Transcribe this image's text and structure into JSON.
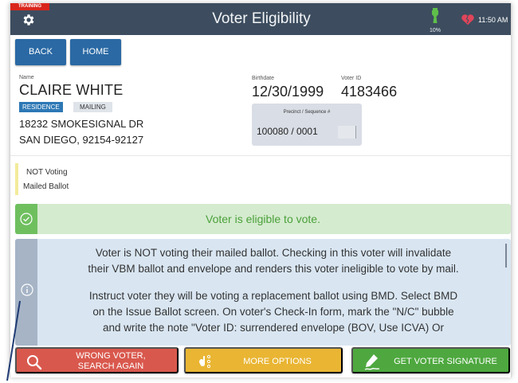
{
  "header": {
    "training_tag": "TRAINING",
    "title": "Voter Eligibility",
    "battery_percent": "10%",
    "clock": "11:50 AM"
  },
  "nav": {
    "back": "BACK",
    "home": "HOME"
  },
  "voter": {
    "name_label": "Name",
    "name": "CLAIRE WHITE",
    "birthdate_label": "Birthdate",
    "birthdate": "12/30/1999",
    "voter_id_label": "Voter ID",
    "voter_id": "4183466",
    "address_tabs": {
      "residence": "RESIDENCE",
      "mailing": "MAILING"
    },
    "address_line1": "18232 SMOKESIGNAL DR",
    "address_line2": "SAN DIEGO, 92154-92127",
    "precinct_label": "Precinct / Sequence #",
    "precinct": "100080 / 0001"
  },
  "status": {
    "line1": "NOT Voting",
    "line2": "Mailed Ballot"
  },
  "eligibility": {
    "message": "Voter is eligible to vote."
  },
  "warning": {
    "line1": "Voter is NOT voting their mailed ballot. Checking in this voter will invalidate",
    "line2": "their VBM ballot and envelope and renders this voter ineligible to vote by mail.",
    "line3": "Instruct voter they will be voting a replacement ballot using BMD. Select BMD",
    "line4": "on the Issue Ballot screen. On voter's Check-In form, mark the \"N/C\" bubble",
    "line5": "and write the note \"Voter ID: surrendered envelope (BOV, Use ICVA) Or"
  },
  "actions": {
    "wrong_voter_line1": "WRONG VOTER,",
    "wrong_voter_line2": "SEARCH AGAIN",
    "more_options": "MORE OPTIONS",
    "get_signature": "GET VOTER SIGNATURE"
  },
  "colors": {
    "header_bg": "#3d4d5f",
    "nav_button": "#2a69a4",
    "eligible_bg": "#d5ebcf",
    "eligible_text": "#4aa13a",
    "warning_bg": "#d9e6f2",
    "wrong_voter": "#d9584d",
    "more_options": "#e9b533",
    "get_signature": "#4ea83f"
  },
  "icons": {
    "settings": "gear-icon",
    "battery": "battery-charging-icon",
    "health": "heart-broken-icon",
    "eligible": "check-circle-icon",
    "info": "info-circle-icon",
    "search": "search-icon",
    "options": "options-icon",
    "signature": "pen-signature-icon"
  }
}
